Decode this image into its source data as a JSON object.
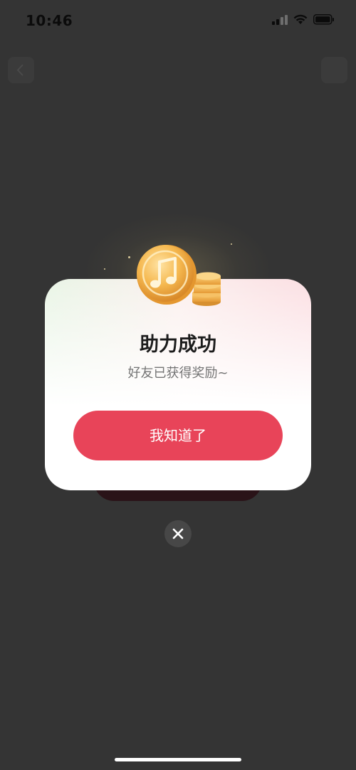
{
  "status_bar": {
    "time": "10:46"
  },
  "modal": {
    "title": "助力成功",
    "subtitle": "好友已获得奖励~",
    "confirm_label": "我知道了"
  },
  "icons": {
    "coin": "music-note-coin-icon",
    "close": "close-icon"
  },
  "colors": {
    "background": "#343434",
    "accent": "#e84459",
    "coin": "#f2b552"
  }
}
